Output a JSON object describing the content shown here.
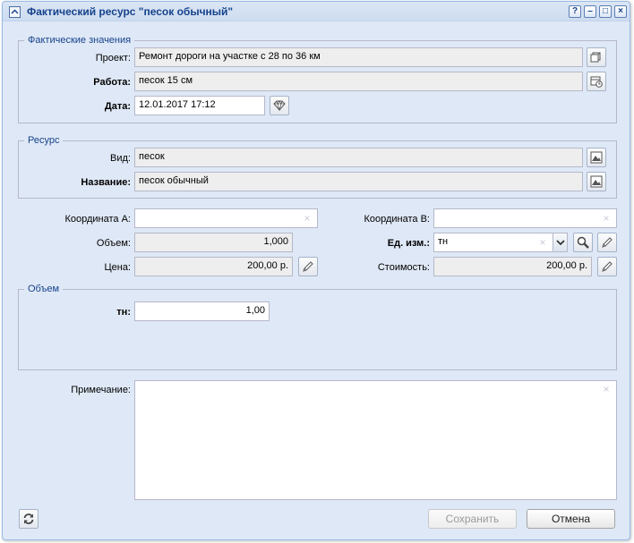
{
  "window": {
    "title": "Фактический ресурс \"песок обычный\"",
    "tools": {
      "help": "?",
      "minimize": "–",
      "maximize": "□",
      "close": "×"
    }
  },
  "actual": {
    "legend": "Фактические значения",
    "project_label": "Проект:",
    "project_value": "Ремонт дороги на участке с 28 по 36 км",
    "work_label": "Работа:",
    "work_value": "песок  15 см",
    "date_label": "Дата:",
    "date_value": "12.01.2017 17:12"
  },
  "resource": {
    "legend": "Ресурс",
    "kind_label": "Вид:",
    "kind_value": "песок",
    "name_label": "Название:",
    "name_value": "песок обычный"
  },
  "params": {
    "coord_a_label": "Координата А:",
    "coord_a_value": "",
    "coord_b_label": "Координата В:",
    "coord_b_value": "",
    "volume_label": "Объем:",
    "volume_value": "1,000",
    "unit_label": "Ед. изм.:",
    "unit_value": "тн",
    "price_label": "Цена:",
    "price_value": "200,00 р.",
    "cost_label": "Стоимость:",
    "cost_value": "200,00 р."
  },
  "volume_group": {
    "legend": "Объем",
    "tn_label": "тн:",
    "tn_value": "1,00"
  },
  "note": {
    "label": "Примечание:",
    "value": ""
  },
  "footer": {
    "save_label": "Сохранить",
    "cancel_label": "Отмена"
  },
  "icons": {
    "project": "copy-icon",
    "work": "calendar-clock-icon",
    "date": "diamond-icon",
    "kind": "picture-icon",
    "name": "picture-icon",
    "unit_search": "search-icon",
    "edit": "pencil-icon",
    "refresh": "refresh-icon"
  }
}
